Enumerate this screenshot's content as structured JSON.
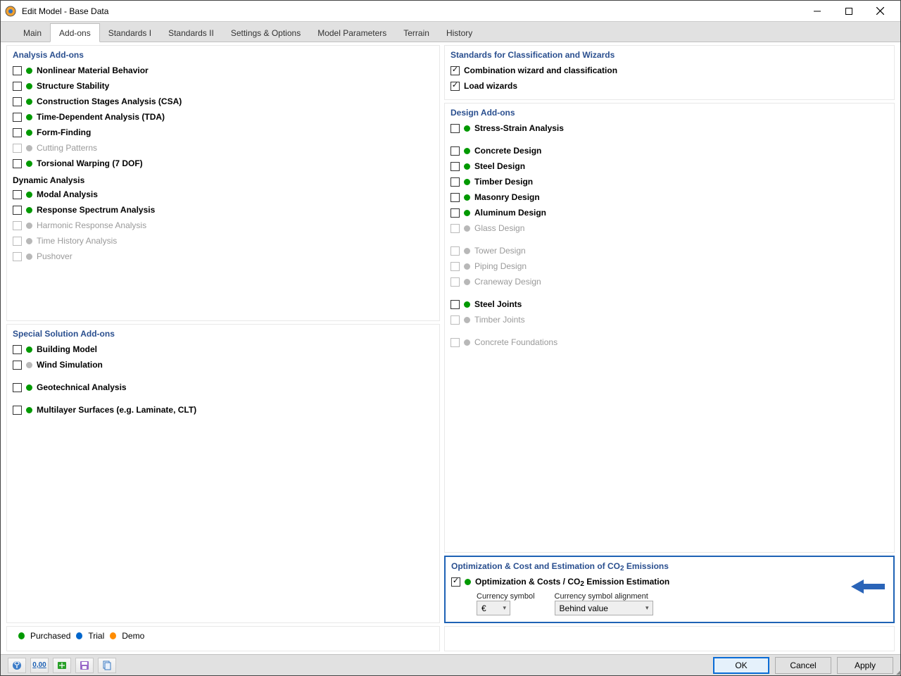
{
  "window": {
    "title": "Edit Model - Base Data"
  },
  "tabs": [
    "Main",
    "Add-ons",
    "Standards I",
    "Standards II",
    "Settings & Options",
    "Model Parameters",
    "Terrain",
    "History"
  ],
  "active_tab": 1,
  "analysis": {
    "title": "Analysis Add-ons",
    "items": [
      {
        "label": "Nonlinear Material Behavior",
        "dot": "green",
        "checked": false,
        "enabled": true
      },
      {
        "label": "Structure Stability",
        "dot": "green",
        "checked": false,
        "enabled": true
      },
      {
        "label": "Construction Stages Analysis (CSA)",
        "dot": "green",
        "checked": false,
        "enabled": true
      },
      {
        "label": "Time-Dependent Analysis (TDA)",
        "dot": "green",
        "checked": false,
        "enabled": true
      },
      {
        "label": "Form-Finding",
        "dot": "green",
        "checked": false,
        "enabled": true
      },
      {
        "label": "Cutting Patterns",
        "dot": "grey",
        "checked": false,
        "enabled": false
      },
      {
        "label": "Torsional Warping (7 DOF)",
        "dot": "green",
        "checked": false,
        "enabled": true
      }
    ],
    "dyn_title": "Dynamic Analysis",
    "dyn_items": [
      {
        "label": "Modal Analysis",
        "dot": "green",
        "checked": false,
        "enabled": true
      },
      {
        "label": "Response Spectrum Analysis",
        "dot": "green",
        "checked": false,
        "enabled": true
      },
      {
        "label": "Harmonic Response Analysis",
        "dot": "grey",
        "checked": false,
        "enabled": false
      },
      {
        "label": "Time History Analysis",
        "dot": "grey",
        "checked": false,
        "enabled": false
      },
      {
        "label": "Pushover",
        "dot": "grey",
        "checked": false,
        "enabled": false
      }
    ]
  },
  "special": {
    "title": "Special Solution Add-ons",
    "items": [
      {
        "label": "Building Model",
        "dot": "green",
        "checked": false,
        "enabled": true
      },
      {
        "label": "Wind Simulation",
        "dot": "grey",
        "checked": false,
        "enabled": true
      },
      {
        "label": "",
        "spacer": true
      },
      {
        "label": "Geotechnical Analysis",
        "dot": "green",
        "checked": false,
        "enabled": true
      },
      {
        "label": "",
        "spacer": true
      },
      {
        "label": "Multilayer Surfaces (e.g. Laminate, CLT)",
        "dot": "green",
        "checked": false,
        "enabled": true
      }
    ]
  },
  "standards": {
    "title": "Standards for Classification and Wizards",
    "items": [
      {
        "label": "Combination wizard and classification",
        "checked": true
      },
      {
        "label": "Load wizards",
        "checked": true
      }
    ]
  },
  "design": {
    "title": "Design Add-ons",
    "items": [
      {
        "label": "Stress-Strain Analysis",
        "dot": "green",
        "checked": false,
        "enabled": true
      },
      {
        "label": "",
        "spacer": true
      },
      {
        "label": "Concrete Design",
        "dot": "green",
        "checked": false,
        "enabled": true
      },
      {
        "label": "Steel Design",
        "dot": "green",
        "checked": false,
        "enabled": true
      },
      {
        "label": "Timber Design",
        "dot": "green",
        "checked": false,
        "enabled": true
      },
      {
        "label": "Masonry Design",
        "dot": "green",
        "checked": false,
        "enabled": true
      },
      {
        "label": "Aluminum Design",
        "dot": "green",
        "checked": false,
        "enabled": true
      },
      {
        "label": "Glass Design",
        "dot": "grey",
        "checked": false,
        "enabled": false
      },
      {
        "label": "",
        "spacer": true
      },
      {
        "label": "Tower Design",
        "dot": "grey",
        "checked": false,
        "enabled": false
      },
      {
        "label": "Piping Design",
        "dot": "grey",
        "checked": false,
        "enabled": false
      },
      {
        "label": "Craneway Design",
        "dot": "grey",
        "checked": false,
        "enabled": false
      },
      {
        "label": "",
        "spacer": true
      },
      {
        "label": "Steel Joints",
        "dot": "green",
        "checked": false,
        "enabled": true
      },
      {
        "label": "Timber Joints",
        "dot": "grey",
        "checked": false,
        "enabled": false
      },
      {
        "label": "",
        "spacer": true
      },
      {
        "label": "Concrete Foundations",
        "dot": "grey",
        "checked": false,
        "enabled": false
      }
    ]
  },
  "optimization": {
    "title_prefix": "Optimization & Cost and Estimation of CO",
    "title_suffix": " Emissions",
    "item_prefix": "Optimization & Costs / CO",
    "item_suffix": " Emission Estimation",
    "sub": "2",
    "checked": true,
    "currency_label": "Currency symbol",
    "currency_value": "€",
    "align_label": "Currency symbol alignment",
    "align_value": "Behind value"
  },
  "legend": {
    "purchased": "Purchased",
    "trial": "Trial",
    "demo": "Demo"
  },
  "buttons": {
    "ok": "OK",
    "cancel": "Cancel",
    "apply": "Apply"
  }
}
